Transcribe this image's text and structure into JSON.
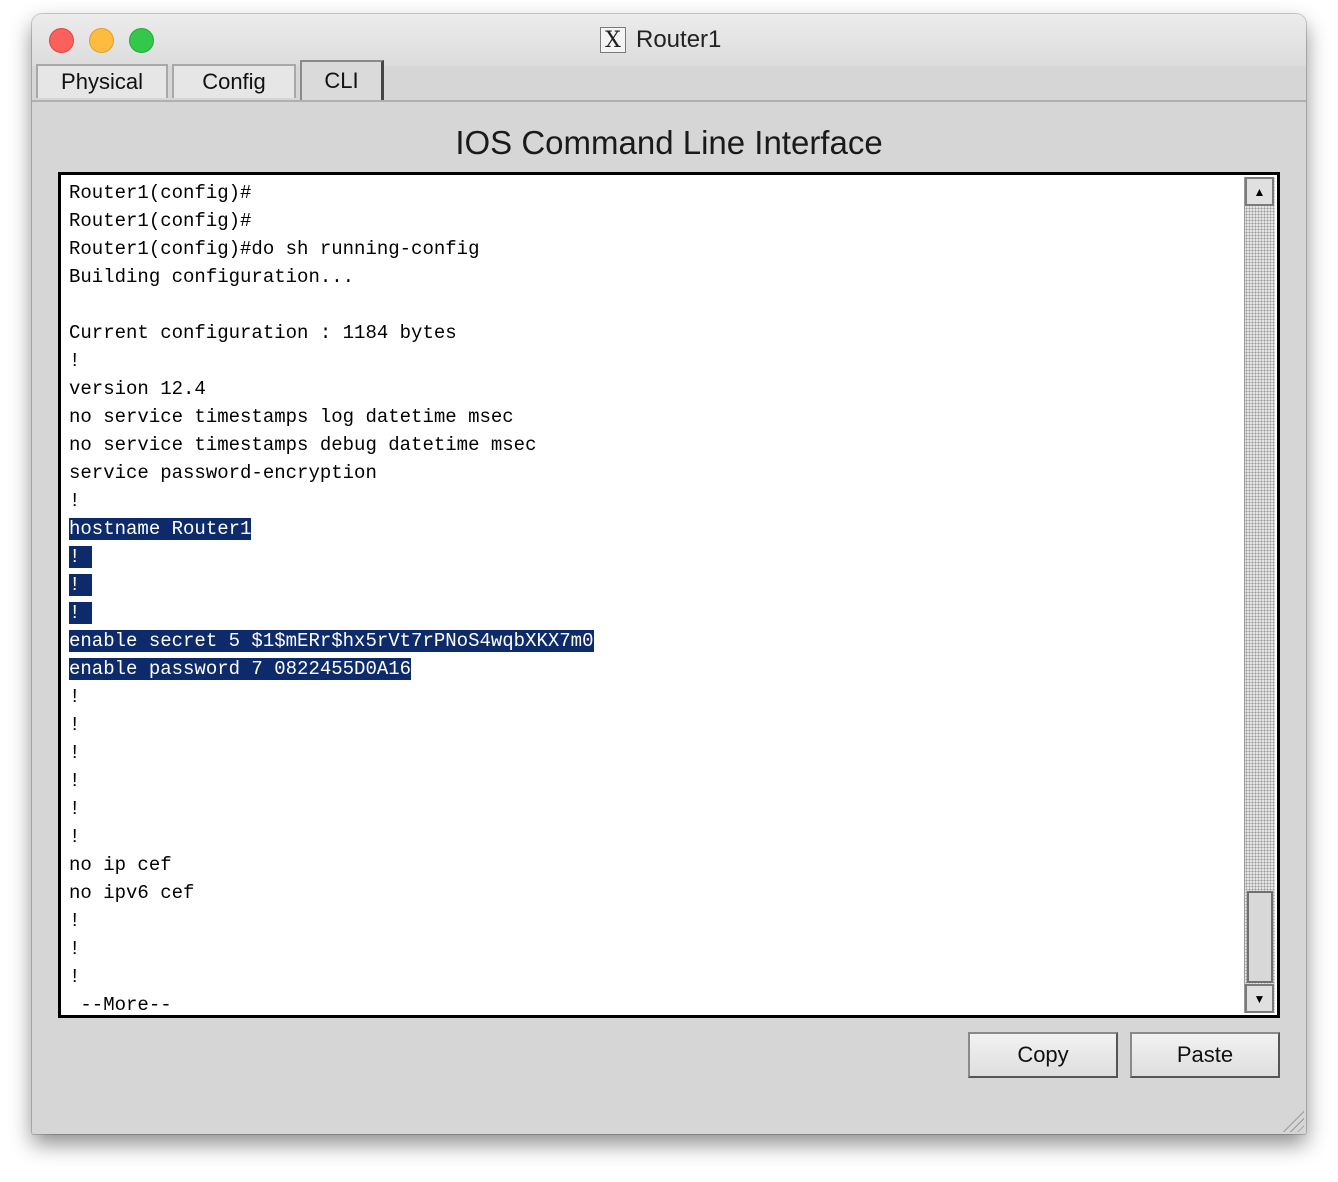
{
  "window": {
    "title": "Router1",
    "app_icon": "x11-icon",
    "controls": [
      "close",
      "minimize",
      "zoom"
    ]
  },
  "tabs": [
    {
      "label": "Physical",
      "active": false
    },
    {
      "label": "Config",
      "active": false
    },
    {
      "label": "CLI",
      "active": true
    }
  ],
  "cli": {
    "heading": "IOS Command Line Interface",
    "lines": [
      {
        "text": "Router1(config)#",
        "selected": false
      },
      {
        "text": "Router1(config)#",
        "selected": false
      },
      {
        "text": "Router1(config)#do sh running-config",
        "selected": false
      },
      {
        "text": "Building configuration...",
        "selected": false
      },
      {
        "text": "",
        "selected": false
      },
      {
        "text": "Current configuration : 1184 bytes",
        "selected": false
      },
      {
        "text": "!",
        "selected": false
      },
      {
        "text": "version 12.4",
        "selected": false
      },
      {
        "text": "no service timestamps log datetime msec",
        "selected": false
      },
      {
        "text": "no service timestamps debug datetime msec",
        "selected": false
      },
      {
        "text": "service password-encryption",
        "selected": false
      },
      {
        "text": "!",
        "selected": false
      },
      {
        "text": "hostname Router1",
        "selected": true
      },
      {
        "text": "! ",
        "selected": true
      },
      {
        "text": "! ",
        "selected": true
      },
      {
        "text": "! ",
        "selected": true
      },
      {
        "text": "enable secret 5 $1$mERr$hx5rVt7rPNoS4wqbXKX7m0",
        "selected": true
      },
      {
        "text": "enable password 7 0822455D0A16",
        "selected": true
      },
      {
        "text": "!",
        "selected": false
      },
      {
        "text": "!",
        "selected": false
      },
      {
        "text": "!",
        "selected": false
      },
      {
        "text": "!",
        "selected": false
      },
      {
        "text": "!",
        "selected": false
      },
      {
        "text": "!",
        "selected": false
      },
      {
        "text": "no ip cef",
        "selected": false
      },
      {
        "text": "no ipv6 cef",
        "selected": false
      },
      {
        "text": "!",
        "selected": false
      },
      {
        "text": "!",
        "selected": false
      },
      {
        "text": "!",
        "selected": false
      },
      {
        "text": " --More--",
        "selected": false
      }
    ],
    "scrollbar": {
      "up_arrow": "▲",
      "down_arrow": "▼",
      "position": 1.0
    }
  },
  "buttons": {
    "copy_label": "Copy",
    "paste_label": "Paste"
  },
  "colors": {
    "selection_bg": "#0d2a6b",
    "selection_fg": "#ffffff",
    "window_bg": "#d6d6d6"
  }
}
